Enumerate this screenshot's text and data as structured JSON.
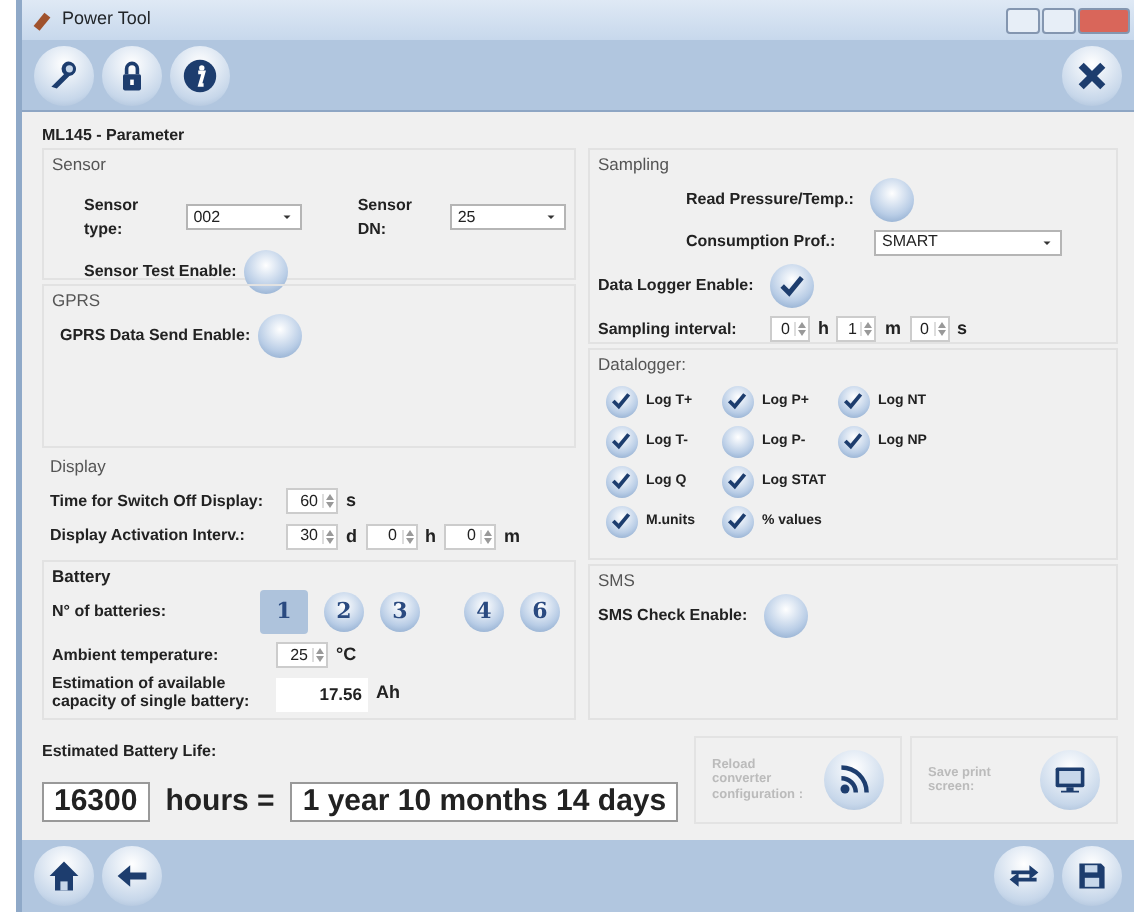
{
  "window": {
    "title": "Power Tool"
  },
  "heading": "ML145 - Parameter",
  "sensor": {
    "title": "Sensor",
    "type_label": "Sensor type:",
    "type_value": "002",
    "dn_label": "Sensor DN:",
    "dn_value": "25",
    "test_label": "Sensor Test Enable:",
    "test_on": false
  },
  "gprs": {
    "title": "GPRS",
    "label": "GPRS Data Send Enable:",
    "on": false
  },
  "display": {
    "title": "Display",
    "rows": [
      {
        "label": "Time for Switch Off Display:",
        "fields": [
          {
            "value": "60",
            "unit": "s"
          }
        ]
      },
      {
        "label": "Display Activation Interv.:",
        "fields": [
          {
            "value": "30",
            "unit": "d"
          },
          {
            "value": "0",
            "unit": "h"
          },
          {
            "value": "0",
            "unit": "m"
          }
        ]
      }
    ]
  },
  "battery": {
    "title": "Battery",
    "count_label": "N° of batteries:",
    "counts": [
      {
        "label": "1",
        "selected": true
      },
      {
        "label": "2",
        "selected": false
      },
      {
        "label": "3",
        "selected": false
      },
      {
        "label": "4",
        "selected": false
      },
      {
        "label": "6",
        "selected": false
      }
    ],
    "temp_label": "Ambient temperature:",
    "temp_value": "25",
    "temp_unit": "°C",
    "capacity_label": "Estimation of available capacity of single battery:",
    "capacity_value": "17.56",
    "capacity_unit": "Ah"
  },
  "sampling": {
    "title": "Sampling",
    "read_label": "Read Pressure/Temp.:",
    "read_on": false,
    "profile_label": "Consumption Prof.:",
    "profile_value": "SMART",
    "logger_label": "Data Logger Enable:",
    "logger_on": true,
    "interval_label": "Sampling interval:",
    "interval_fields": [
      {
        "value": "0",
        "unit": "h"
      },
      {
        "value": "1",
        "unit": "m"
      },
      {
        "value": "0",
        "unit": "s"
      }
    ]
  },
  "datalogger": {
    "title": "Datalogger:",
    "rows": [
      [
        {
          "label": "Log T+",
          "checked": true
        },
        {
          "label": "Log P+",
          "checked": true
        },
        {
          "label": "Log NT",
          "checked": true
        }
      ],
      [
        {
          "label": "Log T-",
          "checked": true
        },
        {
          "label": "Log P-",
          "checked": false
        },
        {
          "label": "Log NP",
          "checked": true
        }
      ],
      [
        {
          "label": "Log Q",
          "checked": true
        },
        {
          "label": "Log STAT",
          "checked": true
        }
      ],
      [
        {
          "label": "M.units",
          "checked": true
        },
        {
          "label": "% values",
          "checked": true
        }
      ]
    ]
  },
  "sms": {
    "title": "SMS",
    "label": "SMS Check Enable:",
    "on": false
  },
  "estimate": {
    "label": "Estimated Battery Life:",
    "hours": "16300",
    "hours_label": "hours =",
    "duration": "1 year  10 months  14 days"
  },
  "actions": [
    {
      "kind": "reload",
      "label": "Reload converter configuration :"
    },
    {
      "kind": "print",
      "label": "Save print screen:"
    }
  ]
}
